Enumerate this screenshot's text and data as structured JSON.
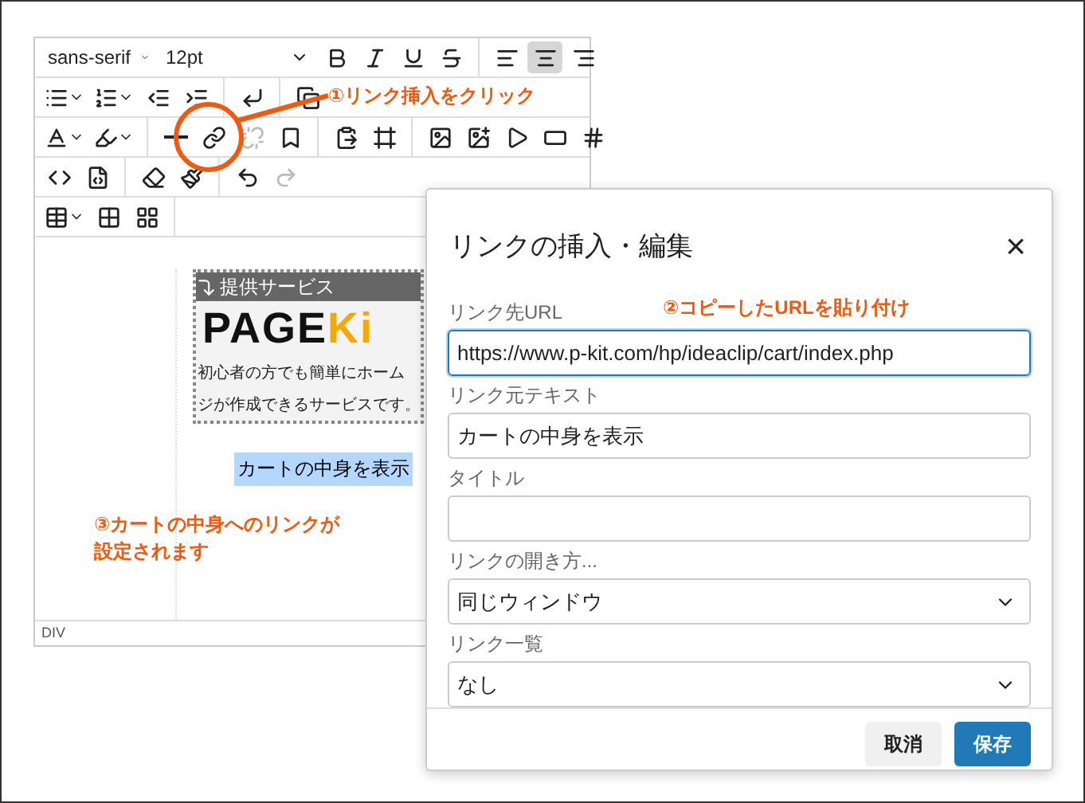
{
  "toolbar": {
    "font": "sans-serif",
    "size": "12pt",
    "align_buttons": [
      {
        "selected": false
      },
      {
        "selected": true
      },
      {
        "selected": false
      }
    ],
    "unlink": {
      "disabled": true
    },
    "redo": {
      "disabled": true
    }
  },
  "editor": {
    "card_title": "提供サービス",
    "logo": {
      "main": "PAGE",
      "accent": "Ki"
    },
    "card_lines": [
      "初心者の方でも簡単にホーム",
      "ジが作成できるサービスです。"
    ],
    "link_text": {
      "text": "カートの中身を表示",
      "selected": true
    },
    "status": "DIV"
  },
  "dialog": {
    "title": "リンクの挿入・編集",
    "close": "×",
    "fields": [
      {
        "kind": "text",
        "label": "リンク先URL",
        "value": "https://www.p-kit.com/hp/ideaclip/cart/index.php",
        "focused": true
      },
      {
        "kind": "text",
        "label": "リンク元テキスト",
        "value": "カートの中身を表示",
        "focused": false
      },
      {
        "kind": "text",
        "label": "タイトル",
        "focused": false
      },
      {
        "kind": "select",
        "label": "リンクの開き方...",
        "value": "同じウィンドウ",
        "focused": false
      },
      {
        "kind": "select",
        "label": "リンク一覧",
        "value": "なし",
        "focused": false
      }
    ],
    "buttons": [
      {
        "kind": "secondary",
        "label": "取消"
      },
      {
        "kind": "primary",
        "label": "保存"
      }
    ]
  },
  "annotations": [
    "①リンク挿入をクリック",
    "②コピーしたURLを貼り付け",
    "③カートの中身へのリンクが設定されます"
  ]
}
